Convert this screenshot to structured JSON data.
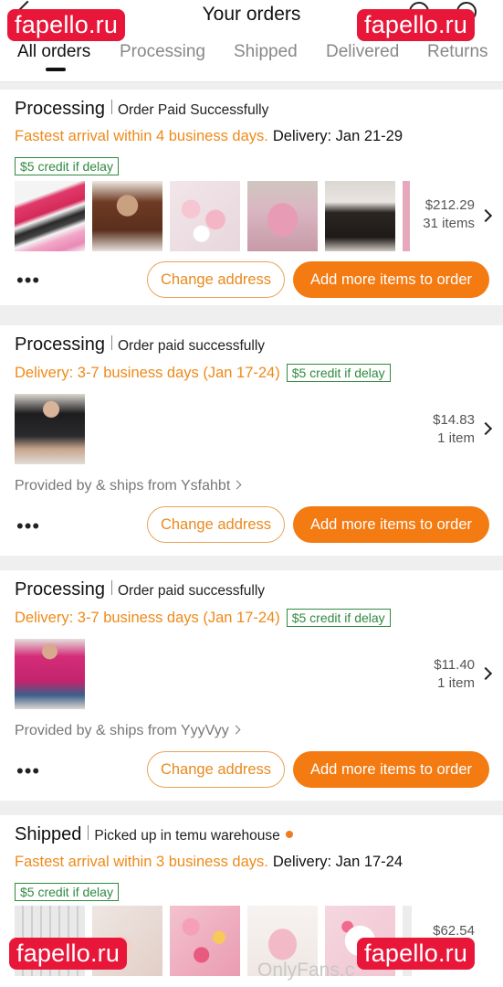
{
  "header": {
    "title": "Your orders",
    "tabs": [
      {
        "label": "All orders",
        "active": true
      },
      {
        "label": "Processing",
        "active": false
      },
      {
        "label": "Shipped",
        "active": false
      },
      {
        "label": "Delivered",
        "active": false
      },
      {
        "label": "Returns",
        "active": false
      }
    ],
    "icons": [
      "back-arrow-icon",
      "search-icon",
      "support-icon"
    ]
  },
  "watermark": {
    "text": "fapello.ru",
    "footer_text": "OnlyFans.c"
  },
  "colors": {
    "accent": "#f47a12",
    "delivery_orange": "#ee8a1a",
    "credit_green": "#2f8a3f",
    "watermark_red": "#e8173a"
  },
  "orders": [
    {
      "status": "Processing",
      "status_note": "Order Paid Successfully",
      "delivery_highlight": "Fastest arrival within 4 business days.",
      "delivery_date": "Delivery: Jan 21-29",
      "credit": "$5 credit if delay",
      "price": "$212.29",
      "count": "31 items",
      "change_address": "Change address",
      "add_more": "Add more items to order",
      "more": "•••"
    },
    {
      "status": "Processing",
      "status_note": "Order paid successfully",
      "delivery_highlight": "Delivery: 3-7 business days (Jan 17-24)",
      "credit": "$5 credit if delay",
      "price": "$14.83",
      "count": "1 item",
      "provider": "Provided by & ships from Ysfahbt",
      "change_address": "Change address",
      "add_more": "Add more items to order",
      "more": "•••"
    },
    {
      "status": "Processing",
      "status_note": "Order paid successfully",
      "delivery_highlight": "Delivery: 3-7 business days (Jan 17-24)",
      "credit": "$5 credit if delay",
      "price": "$11.40",
      "count": "1 item",
      "provider": "Provided by & ships from YyyVyy",
      "change_address": "Change address",
      "add_more": "Add more items to order",
      "more": "•••"
    },
    {
      "status": "Shipped",
      "status_note": "Picked up in temu warehouse",
      "delivery_highlight": "Fastest arrival within 3 business days.",
      "delivery_date": "Delivery: Jan 17-24",
      "credit": "$5 credit if delay",
      "price": "$62.54"
    }
  ]
}
